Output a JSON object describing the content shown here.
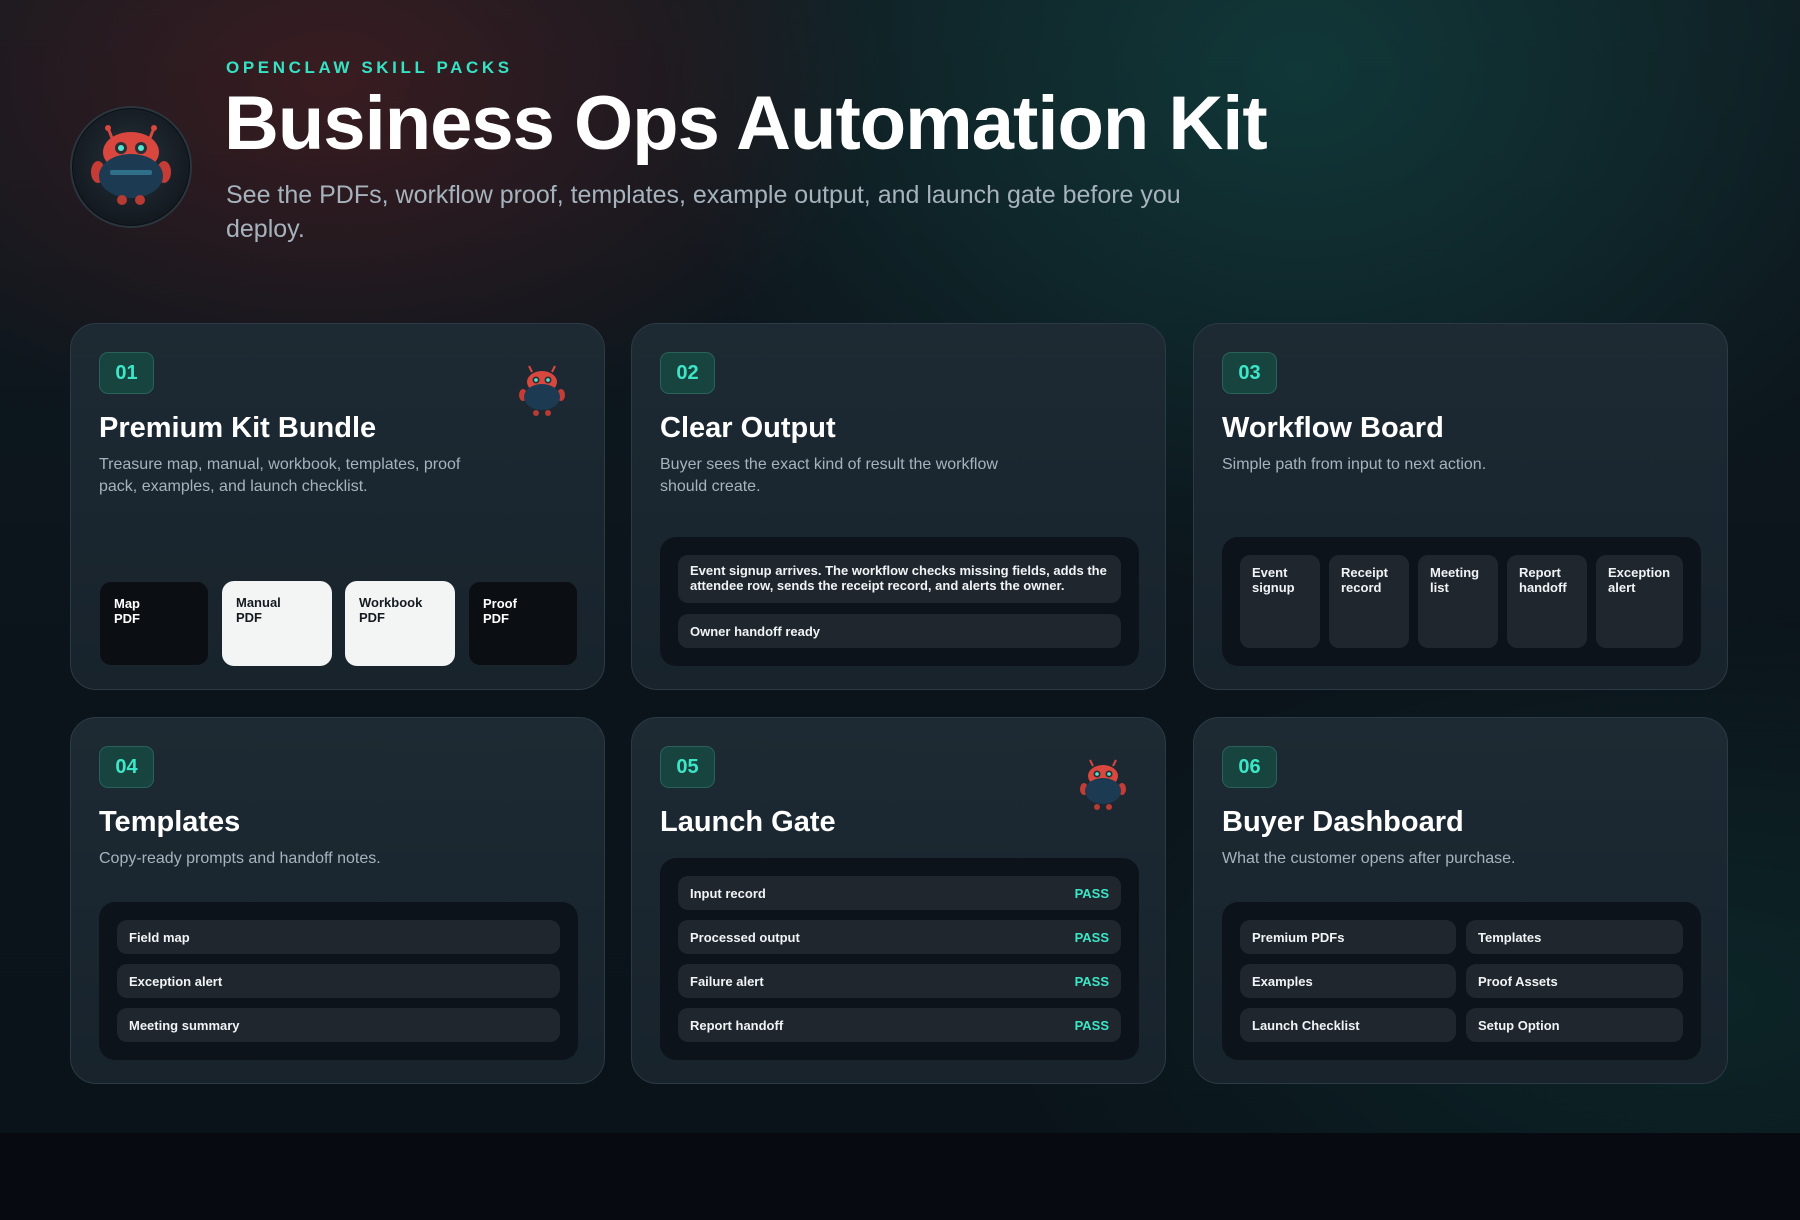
{
  "hero": {
    "eyebrow": "OPENCLAW SKILL PACKS",
    "title": "Business Ops Automation Kit",
    "subtitle": "See the PDFs, workflow proof, templates, example output, and launch gate before you deploy."
  },
  "cards": [
    {
      "number": "01",
      "title": "Premium Kit Bundle",
      "description": "Treasure map, manual, workbook, templates, proof pack, examples, and launch checklist.",
      "pdfs": [
        "Map\nPDF",
        "Manual\nPDF",
        "Workbook\nPDF",
        "Proof\nPDF"
      ]
    },
    {
      "number": "02",
      "title": "Clear Output",
      "description": "Buyer sees the exact kind of result the workflow should create.",
      "output_text": "Event signup arrives. The workflow checks missing fields, adds the attendee row, sends the receipt record, and alerts the owner.",
      "handoff": "Owner handoff ready"
    },
    {
      "number": "03",
      "title": "Workflow Board",
      "description": "Simple path from input to next action.",
      "steps": [
        "Event\nsignup",
        "Receipt\nrecord",
        "Meeting\nlist",
        "Report\nhandoff",
        "Exception\nalert"
      ]
    },
    {
      "number": "04",
      "title": "Templates",
      "description": "Copy-ready prompts and handoff notes.",
      "items": [
        "Field map",
        "Exception alert",
        "Meeting summary"
      ]
    },
    {
      "number": "05",
      "title": "Launch Gate",
      "checks": [
        {
          "label": "Input record",
          "status": "PASS"
        },
        {
          "label": "Processed output",
          "status": "PASS"
        },
        {
          "label": "Failure alert",
          "status": "PASS"
        },
        {
          "label": "Report handoff",
          "status": "PASS"
        }
      ]
    },
    {
      "number": "06",
      "title": "Buyer Dashboard",
      "description": "What the customer opens after purchase.",
      "items": [
        "Premium PDFs",
        "Templates",
        "Examples",
        "Proof Assets",
        "Launch Checklist",
        "Setup Option"
      ]
    }
  ],
  "colors": {
    "accent": "#3de6c7",
    "card_bg": "#1b2730",
    "inner_bg": "#0d131a",
    "mascot_red": "#d9473f",
    "mascot_body": "#1c3a52"
  },
  "icons": {
    "hero_avatar": "robot-mascot-icon",
    "card_mascot": "robot-mascot-icon"
  }
}
